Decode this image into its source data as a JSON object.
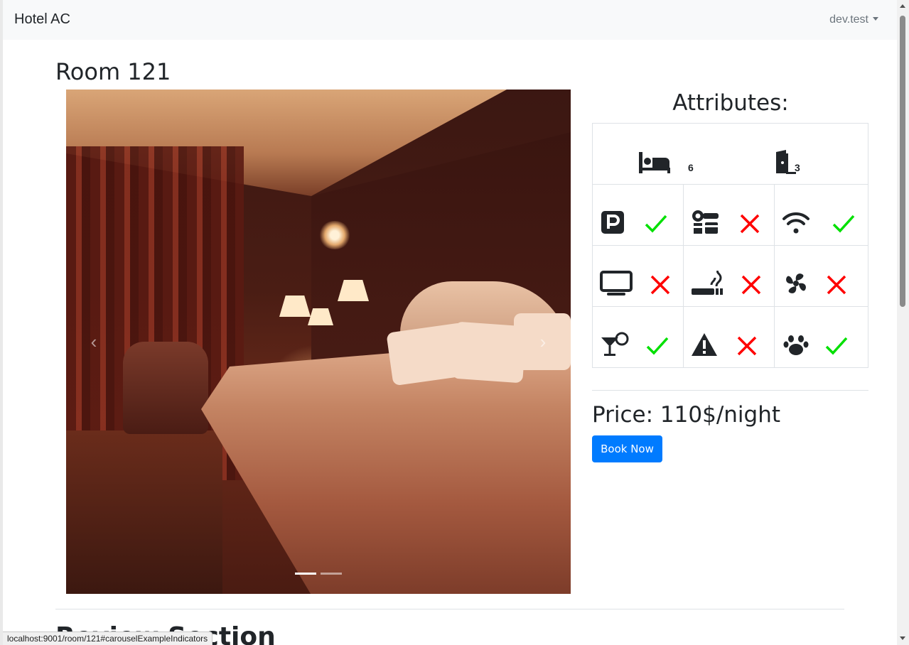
{
  "navbar": {
    "brand": "Hotel AC",
    "user": "dev.test"
  },
  "room": {
    "title": "Room 121"
  },
  "carousel": {
    "prev_glyph": "‹",
    "next_glyph": "›",
    "slides_count_label": "2 slides",
    "active_slide": 1
  },
  "attributes": {
    "title": "Attributes:",
    "beds": "6",
    "doors": "3",
    "amenities": [
      {
        "icon": "parking-icon",
        "available": true
      },
      {
        "icon": "hair-dryer-icon",
        "available": false
      },
      {
        "icon": "wifi-icon",
        "available": true
      },
      {
        "icon": "tv-icon",
        "available": false
      },
      {
        "icon": "smoking-icon",
        "available": false
      },
      {
        "icon": "fan-icon",
        "available": false
      },
      {
        "icon": "cocktail-icon",
        "available": true
      },
      {
        "icon": "warning-icon",
        "available": false
      },
      {
        "icon": "paw-icon",
        "available": true
      }
    ]
  },
  "price": {
    "label": "Price: 110$/night"
  },
  "book": {
    "label": "Book Now"
  },
  "next_section": {
    "heading": "Review Section"
  },
  "statusbar": {
    "url": "localhost:9001/room/121#carouselExampleIndicators"
  },
  "colors": {
    "check": "#00e000",
    "cross": "#ff0000",
    "primary": "#007bff"
  }
}
